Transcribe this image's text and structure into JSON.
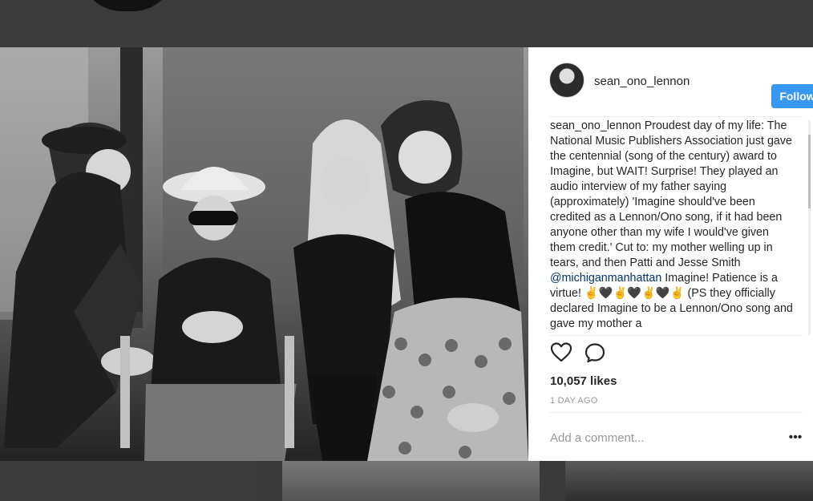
{
  "post": {
    "username": "sean_ono_lennon",
    "follow_label": "Follow",
    "caption_username": "sean_ono_lennon",
    "caption_text_1": "Proudest day of my life: The National Music Publishers Association just gave the centennial (song of the century) award to Imagine, but WAIT! Surprise! They played an audio interview of my father saying (approximately) 'Imagine should've been credited as a Lennon/Ono song, if it had been anyone other than my wife I would've given them credit.' Cut to: my mother welling up in tears, and then Patti and Jesse Smith",
    "mention": "@michiganmanhattan",
    "caption_text_2": "Imagine! Patience is a virtue! ✌🖤✌🖤✌🖤✌ (PS they officially declared Imagine to be a Lennon/Ono song and gave my mother a",
    "likes": "10,057 likes",
    "date": "1 DAY AGO",
    "comment_placeholder": "Add a comment...",
    "more_label": "•••"
  },
  "icons": {
    "like": "heart-icon",
    "comment": "comment-icon"
  },
  "colors": {
    "follow": "#3897f0",
    "mention": "#003569",
    "photo_tone": "black-and-white"
  }
}
